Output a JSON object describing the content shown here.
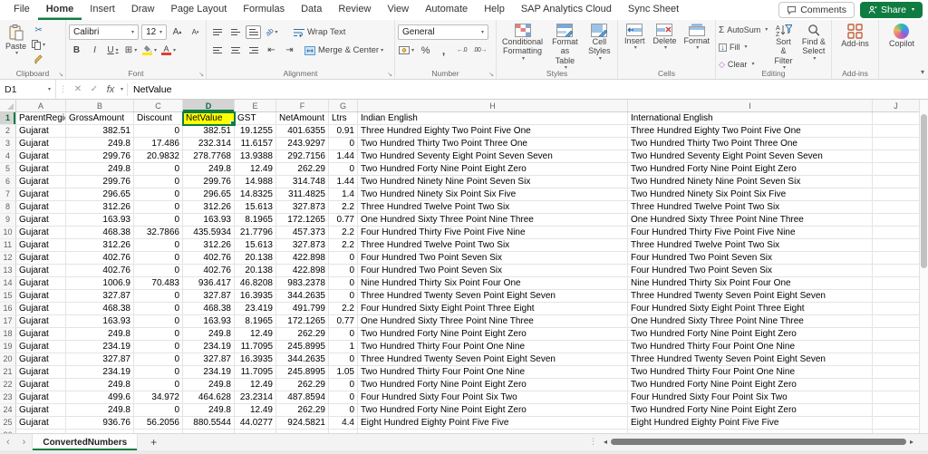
{
  "colors": {
    "accent_green": "#107C41",
    "selection_yellow": "#FFFF00"
  },
  "menu": {
    "tabs": [
      "File",
      "Home",
      "Insert",
      "Draw",
      "Page Layout",
      "Formulas",
      "Data",
      "Review",
      "View",
      "Automate",
      "Help",
      "SAP Analytics Cloud",
      "Sync Sheet"
    ],
    "active_tab": "Home",
    "comments_label": "Comments",
    "share_label": "Share"
  },
  "ribbon": {
    "clipboard": {
      "group_label": "Clipboard",
      "paste_label": "Paste"
    },
    "font": {
      "group_label": "Font",
      "font_name": "Calibri",
      "font_size": "12",
      "bold": "B",
      "italic": "I",
      "underline": "U"
    },
    "alignment": {
      "group_label": "Alignment",
      "wrap_text_label": "Wrap Text",
      "merge_center_label": "Merge & Center"
    },
    "number": {
      "group_label": "Number",
      "format_value": "General"
    },
    "styles": {
      "group_label": "Styles",
      "conditional_formatting_label": "Conditional Formatting",
      "format_as_table_label": "Format as Table",
      "cell_styles_label": "Cell Styles"
    },
    "cells": {
      "group_label": "Cells",
      "insert_label": "Insert",
      "delete_label": "Delete",
      "format_label": "Format"
    },
    "editing": {
      "group_label": "Editing",
      "autosum_label": "AutoSum",
      "fill_label": "Fill",
      "clear_label": "Clear",
      "sort_filter_label": "Sort & Filter",
      "find_select_label": "Find & Select"
    },
    "addins": {
      "group_label": "Add-ins",
      "addins_label": "Add-ins",
      "copilot_label": "Copilot"
    }
  },
  "formula_bar": {
    "cell_reference": "D1",
    "formula_content": "NetValue"
  },
  "sheet": {
    "active_tab_name": "ConvertedNumbers",
    "column_letters": [
      "A",
      "B",
      "C",
      "D",
      "E",
      "F",
      "G",
      "H",
      "I",
      "J"
    ],
    "selected_column": "D",
    "selected_row": "1",
    "header_row": [
      "ParentRegion",
      "GrossAmount",
      "Discount",
      "NetValue",
      "GST",
      "NetAmount",
      "Ltrs",
      "Indian English",
      "International English"
    ],
    "rows": [
      [
        "Gujarat",
        "382.51",
        "0",
        "382.51",
        "19.1255",
        "401.6355",
        "0.91",
        "Three Hundred Eighty Two Point Five One",
        "Three Hundred Eighty Two Point Five One"
      ],
      [
        "Gujarat",
        "249.8",
        "17.486",
        "232.314",
        "11.6157",
        "243.9297",
        "0",
        "Two Hundred Thirty Two Point Three One",
        "Two Hundred Thirty Two Point Three One"
      ],
      [
        "Gujarat",
        "299.76",
        "20.9832",
        "278.7768",
        "13.9388",
        "292.7156",
        "1.44",
        "Two Hundred Seventy Eight Point Seven Seven",
        "Two Hundred Seventy Eight Point Seven Seven"
      ],
      [
        "Gujarat",
        "249.8",
        "0",
        "249.8",
        "12.49",
        "262.29",
        "0",
        "Two Hundred Forty Nine Point Eight Zero",
        "Two Hundred Forty Nine Point Eight Zero"
      ],
      [
        "Gujarat",
        "299.76",
        "0",
        "299.76",
        "14.988",
        "314.748",
        "1.44",
        "Two Hundred Ninety Nine Point Seven Six",
        "Two Hundred Ninety Nine Point Seven Six"
      ],
      [
        "Gujarat",
        "296.65",
        "0",
        "296.65",
        "14.8325",
        "311.4825",
        "1.4",
        "Two Hundred Ninety Six Point Six Five",
        "Two Hundred Ninety Six Point Six Five"
      ],
      [
        "Gujarat",
        "312.26",
        "0",
        "312.26",
        "15.613",
        "327.873",
        "2.2",
        "Three Hundred Twelve Point Two Six",
        "Three Hundred Twelve Point Two Six"
      ],
      [
        "Gujarat",
        "163.93",
        "0",
        "163.93",
        "8.1965",
        "172.1265",
        "0.77",
        "One Hundred Sixty Three Point Nine Three",
        "One Hundred Sixty Three Point Nine Three"
      ],
      [
        "Gujarat",
        "468.38",
        "32.7866",
        "435.5934",
        "21.7796",
        "457.373",
        "2.2",
        "Four Hundred Thirty Five Point Five Nine",
        "Four Hundred Thirty Five Point Five Nine"
      ],
      [
        "Gujarat",
        "312.26",
        "0",
        "312.26",
        "15.613",
        "327.873",
        "2.2",
        "Three Hundred Twelve Point Two Six",
        "Three Hundred Twelve Point Two Six"
      ],
      [
        "Gujarat",
        "402.76",
        "0",
        "402.76",
        "20.138",
        "422.898",
        "0",
        "Four Hundred Two Point Seven Six",
        "Four Hundred Two Point Seven Six"
      ],
      [
        "Gujarat",
        "402.76",
        "0",
        "402.76",
        "20.138",
        "422.898",
        "0",
        "Four Hundred Two Point Seven Six",
        "Four Hundred Two Point Seven Six"
      ],
      [
        "Gujarat",
        "1006.9",
        "70.483",
        "936.417",
        "46.8208",
        "983.2378",
        "0",
        "Nine Hundred Thirty Six Point Four One",
        "Nine Hundred Thirty Six Point Four One"
      ],
      [
        "Gujarat",
        "327.87",
        "0",
        "327.87",
        "16.3935",
        "344.2635",
        "0",
        "Three Hundred Twenty Seven Point Eight Seven",
        "Three Hundred Twenty Seven Point Eight Seven"
      ],
      [
        "Gujarat",
        "468.38",
        "0",
        "468.38",
        "23.419",
        "491.799",
        "2.2",
        "Four Hundred Sixty Eight Point Three Eight",
        "Four Hundred Sixty Eight Point Three Eight"
      ],
      [
        "Gujarat",
        "163.93",
        "0",
        "163.93",
        "8.1965",
        "172.1265",
        "0.77",
        "One Hundred Sixty Three Point Nine Three",
        "One Hundred Sixty Three Point Nine Three"
      ],
      [
        "Gujarat",
        "249.8",
        "0",
        "249.8",
        "12.49",
        "262.29",
        "0",
        "Two Hundred Forty Nine Point Eight Zero",
        "Two Hundred Forty Nine Point Eight Zero"
      ],
      [
        "Gujarat",
        "234.19",
        "0",
        "234.19",
        "11.7095",
        "245.8995",
        "1",
        "Two Hundred Thirty Four Point One Nine",
        "Two Hundred Thirty Four Point One Nine"
      ],
      [
        "Gujarat",
        "327.87",
        "0",
        "327.87",
        "16.3935",
        "344.2635",
        "0",
        "Three Hundred Twenty Seven Point Eight Seven",
        "Three Hundred Twenty Seven Point Eight Seven"
      ],
      [
        "Gujarat",
        "234.19",
        "0",
        "234.19",
        "11.7095",
        "245.8995",
        "1.05",
        "Two Hundred Thirty Four Point One Nine",
        "Two Hundred Thirty Four Point One Nine"
      ],
      [
        "Gujarat",
        "249.8",
        "0",
        "249.8",
        "12.49",
        "262.29",
        "0",
        "Two Hundred Forty Nine Point Eight Zero",
        "Two Hundred Forty Nine Point Eight Zero"
      ],
      [
        "Gujarat",
        "499.6",
        "34.972",
        "464.628",
        "23.2314",
        "487.8594",
        "0",
        "Four Hundred Sixty Four Point Six Two",
        "Four Hundred Sixty Four Point Six Two"
      ],
      [
        "Gujarat",
        "249.8",
        "0",
        "249.8",
        "12.49",
        "262.29",
        "0",
        "Two Hundred Forty Nine Point Eight Zero",
        "Two Hundred Forty Nine Point Eight Zero"
      ],
      [
        "Gujarat",
        "936.76",
        "56.2056",
        "880.5544",
        "44.0277",
        "924.5821",
        "4.4",
        "Eight Hundred Eighty Point Five Five",
        "Eight Hundred Eighty Point Five Five"
      ]
    ]
  }
}
